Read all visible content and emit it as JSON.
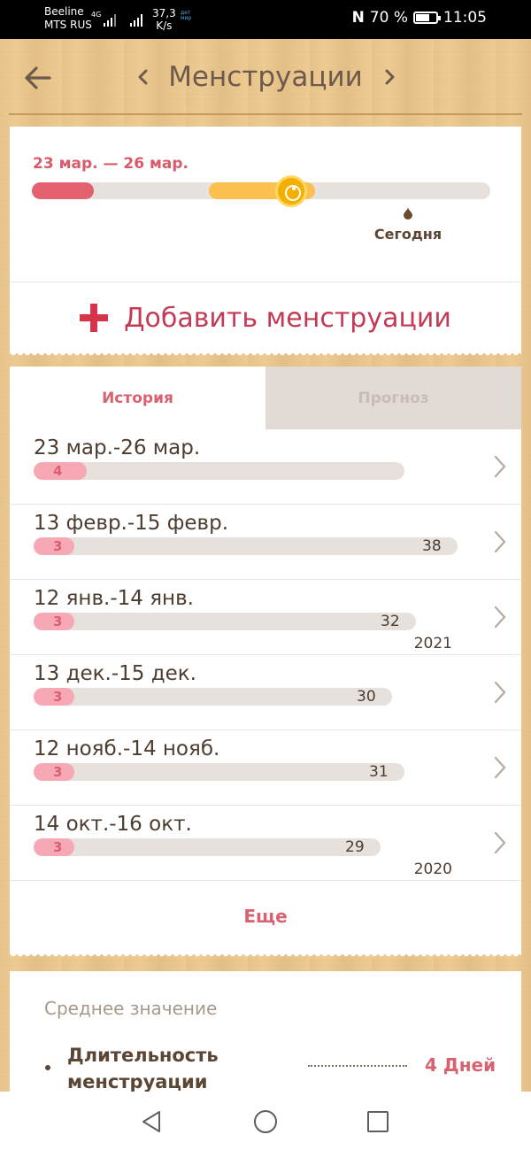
{
  "status_bar": {
    "carrier_1": "Beeline",
    "carrier_2": "MTS RUS",
    "network": "4G",
    "speed_value": "37,3",
    "speed_unit": "K/s",
    "app_badge": "дет мир",
    "battery_percent": "70 %",
    "battery_level": 0.7,
    "time": "11:05"
  },
  "header": {
    "title": "Менструации",
    "back_icon": "arrow-left-icon",
    "prev_icon": "chevron-left-icon",
    "next_icon": "chevron-right-icon"
  },
  "current_cycle": {
    "range_label": "23 мар. — 26 мар.",
    "today_label": "Сегодня",
    "colors": {
      "period": "#e3606e",
      "fertile": "#fbc04f",
      "track": "#e7e1dd"
    }
  },
  "add_button": {
    "label": "Добавить менструации",
    "icon": "plus-icon"
  },
  "tabs": [
    {
      "label": "История",
      "active": true
    },
    {
      "label": "Прогноз",
      "active": false
    }
  ],
  "history": [
    {
      "dates": "23 мар.-26 мар.",
      "period_days": "4",
      "cycle_days": "",
      "year": ""
    },
    {
      "dates": "13 февр.-15 февр.",
      "period_days": "3",
      "cycle_days": "38",
      "year": ""
    },
    {
      "dates": "12 янв.-14 янв.",
      "period_days": "3",
      "cycle_days": "32",
      "year": "2021"
    },
    {
      "dates": "13 дек.-15 дек.",
      "period_days": "3",
      "cycle_days": "30",
      "year": ""
    },
    {
      "dates": "12 нояб.-14 нояб.",
      "period_days": "3",
      "cycle_days": "31",
      "year": ""
    },
    {
      "dates": "14 окт.-16 окт.",
      "period_days": "3",
      "cycle_days": "29",
      "year": "2020"
    }
  ],
  "more_label": "Еще",
  "average": {
    "title": "Среднее значение",
    "items": [
      {
        "label": "Длительность менструации",
        "value": "4 Дней"
      }
    ]
  },
  "accent_color": "#d96270"
}
